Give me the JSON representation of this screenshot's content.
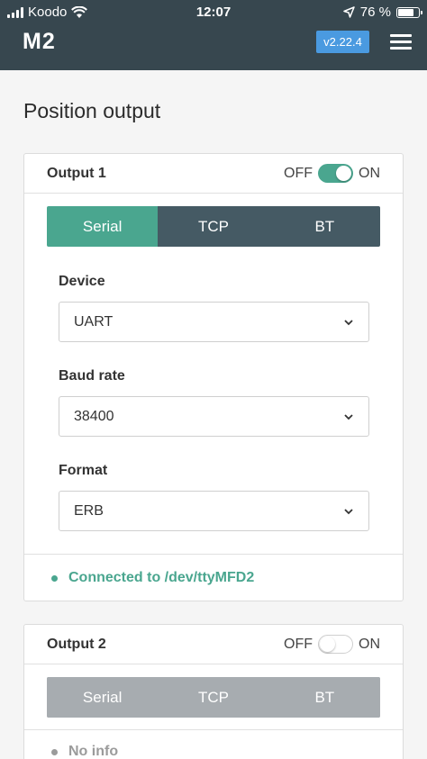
{
  "status_bar": {
    "carrier": "Koodo",
    "time": "12:07",
    "battery": "76 %",
    "battery_level": 0.76
  },
  "header": {
    "logo": "M2",
    "version": "v2.22.4"
  },
  "page": {
    "title": "Position output"
  },
  "output1": {
    "title": "Output 1",
    "toggle_off_label": "OFF",
    "toggle_on_label": "ON",
    "toggle_state": "on",
    "tabs": [
      "Serial",
      "TCP",
      "BT"
    ],
    "active_tab": "Serial",
    "device": {
      "label": "Device",
      "value": "UART"
    },
    "baud_rate": {
      "label": "Baud rate",
      "value": "38400"
    },
    "format": {
      "label": "Format",
      "value": "ERB"
    },
    "status": "Connected to /dev/ttyMFD2"
  },
  "output2": {
    "title": "Output 2",
    "toggle_off_label": "OFF",
    "toggle_on_label": "ON",
    "toggle_state": "off",
    "tabs": [
      "Serial",
      "TCP",
      "BT"
    ],
    "status": "No info"
  },
  "colors": {
    "header_bg": "#37474f",
    "accent_green": "#4aa68f",
    "version_badge": "#4a9ae0",
    "tab_idle": "#455a64",
    "tab_disabled": "#a7acb0"
  }
}
